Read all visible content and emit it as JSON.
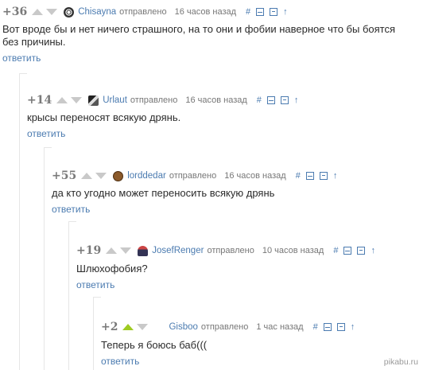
{
  "comments": [
    {
      "rating": "+36",
      "author": "Chisayna",
      "sent": "отправлено",
      "time": "16 часов назад",
      "text": "Вот вроде бы и нет ничего страшного, на то они и фобии наверное что бы боятся без причины.",
      "reply": "ответить",
      "upvoted": false,
      "tools": [
        "#",
        "minus-box-icon",
        "save-icon",
        "↑"
      ]
    },
    {
      "rating": "+14",
      "author": "Urlaut",
      "sent": "отправлено",
      "time": "16 часов назад",
      "text": "крысы переносят всякую дрянь.",
      "reply": "ответить",
      "upvoted": false,
      "tools": [
        "#",
        "minus-box-icon",
        "save-icon",
        "↑"
      ]
    },
    {
      "rating": "+55",
      "author": "lorddedar",
      "sent": "отправлено",
      "time": "16 часов назад",
      "text": "да кто угодно может переносить всякую дрянь",
      "reply": "ответить",
      "upvoted": false,
      "tools": [
        "#",
        "minus-box-icon",
        "save-icon",
        "↑"
      ]
    },
    {
      "rating": "+19",
      "author": "JosefRenger",
      "sent": "отправлено",
      "time": "10 часов назад",
      "text": "Шлюхофобия?",
      "reply": "ответить",
      "upvoted": false,
      "tools": [
        "#",
        "minus-box-icon",
        "save-icon",
        "↑"
      ]
    },
    {
      "rating": "+2",
      "author": "Gisboo",
      "sent": "отправлено",
      "time": "1 час назад",
      "text": "Теперь я боюсь баб(((",
      "reply": "ответить",
      "upvoted": true,
      "tools": [
        "#",
        "minus-box-icon",
        "save-icon",
        "↑"
      ]
    }
  ],
  "watermark": "pikabu.ru",
  "colors": {
    "link": "#4b7bb0",
    "upvote_active": "#9fcb22",
    "vote_inactive": "#c9c9c9"
  }
}
